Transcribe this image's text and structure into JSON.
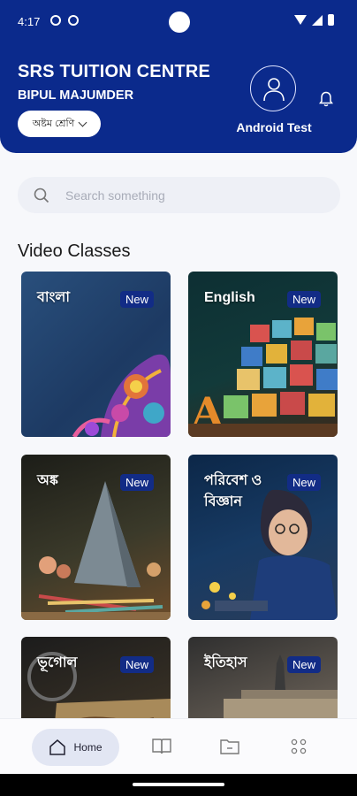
{
  "status_bar": {
    "time": "4:17"
  },
  "header": {
    "org_name": "SRS TUITION CENTRE",
    "teacher_name": "BIPUL MAJUMDER",
    "class_selector": "অষ্টম শ্রেণি",
    "user_name": "Android Test"
  },
  "search": {
    "placeholder": "Search something"
  },
  "section": {
    "title": "Video Classes"
  },
  "subjects": [
    {
      "title": "বাংলা",
      "badge": "New"
    },
    {
      "title": "English",
      "badge": "New"
    },
    {
      "title": "অঙ্ক",
      "badge": "New"
    },
    {
      "title": "পরিবেশ ও বিজ্ঞান",
      "badge": "New"
    },
    {
      "title": "ভূগোল",
      "badge": "New"
    },
    {
      "title": "ইতিহাস",
      "badge": "New"
    }
  ],
  "bottom_nav": {
    "home_label": "Home"
  },
  "colors": {
    "primary": "#0b2a8c",
    "badge": "#122c86",
    "background": "#f7f8fb"
  }
}
